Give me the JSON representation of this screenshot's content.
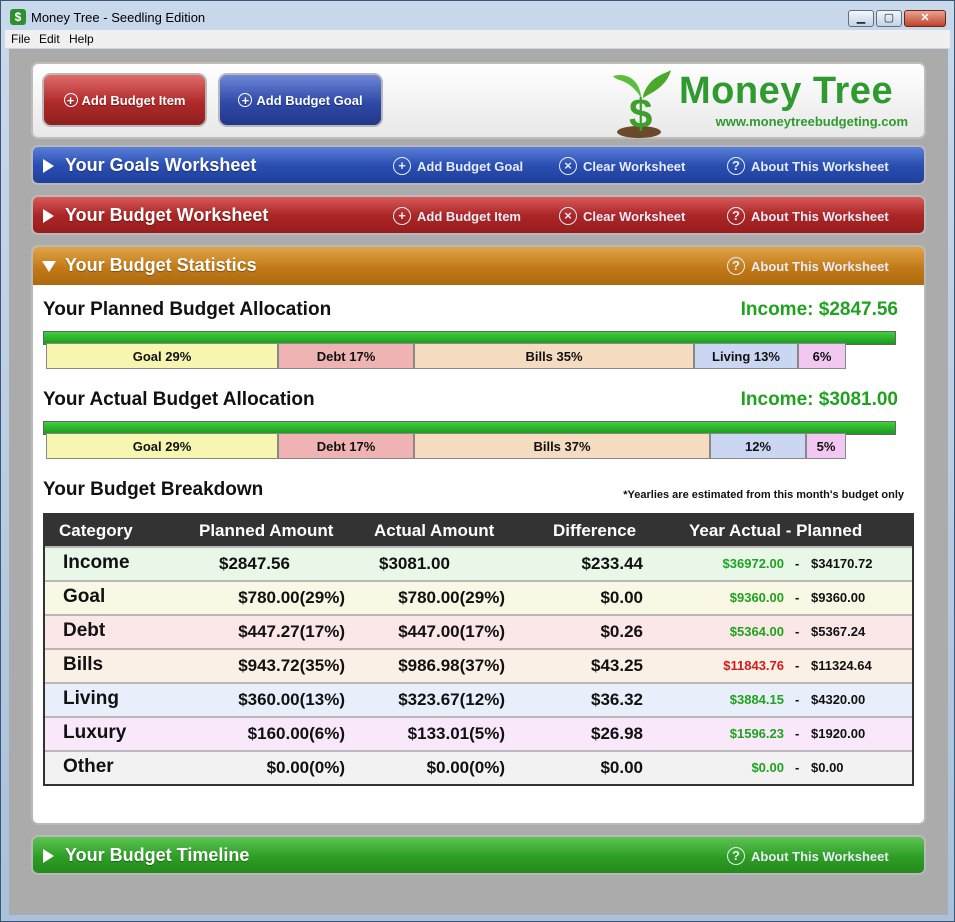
{
  "window": {
    "title": "Money Tree - Seedling Edition",
    "app_icon": "$"
  },
  "menu": [
    "File",
    "Edit",
    "Help"
  ],
  "header": {
    "add_item_label": "Add Budget Item",
    "add_goal_label": "Add Budget Goal",
    "logo_title": "Money Tree",
    "logo_url": "www.moneytreebudgeting.com"
  },
  "goals_section": {
    "title": "Your Goals Worksheet",
    "actions": [
      "Add Budget Goal",
      "Clear Worksheet",
      "About This Worksheet"
    ]
  },
  "budget_section": {
    "title": "Your Budget Worksheet",
    "actions": [
      "Add Budget Item",
      "Clear Worksheet",
      "About This Worksheet"
    ]
  },
  "stats_section": {
    "title": "Your Budget Statistics",
    "about": "About This Worksheet",
    "planned": {
      "title": "Your Planned Budget Allocation",
      "income": "Income: $2847.56",
      "segments": [
        {
          "label": "Goal 29%",
          "pct": 29,
          "color": "#f6f6b0"
        },
        {
          "label": "Debt 17%",
          "pct": 17,
          "color": "#f0b3b3"
        },
        {
          "label": "Bills 35%",
          "pct": 35,
          "color": "#f5dcc0"
        },
        {
          "label": "Living 13%",
          "pct": 13,
          "color": "#cad6f2"
        },
        {
          "label": "6%",
          "pct": 6,
          "color": "#f2c8f2"
        }
      ]
    },
    "actual": {
      "title": "Your Actual Budget Allocation",
      "income": "Income: $3081.00",
      "segments": [
        {
          "label": "Goal 29%",
          "pct": 29,
          "color": "#f6f6b0"
        },
        {
          "label": "Debt 17%",
          "pct": 17,
          "color": "#f0b3b3"
        },
        {
          "label": "Bills 37%",
          "pct": 37,
          "color": "#f5dcc0"
        },
        {
          "label": "12%",
          "pct": 12,
          "color": "#cad6f2"
        },
        {
          "label": "5%",
          "pct": 5,
          "color": "#f2c8f2"
        }
      ]
    },
    "breakdown": {
      "title": "Your Budget Breakdown",
      "note": "*Yearlies are estimated from this month's budget only",
      "headers": [
        "Category",
        "Planned Amount",
        "Actual Amount",
        "Difference",
        "Year Actual - Planned"
      ],
      "rows": [
        {
          "category": "Income",
          "planned": "$2847.56",
          "actual": "$3081.00",
          "diff": "$233.44",
          "year_actual": "$36972.00",
          "year_planned": "$34170.72",
          "bg": "#e8f7e8",
          "ya_color": "#1fa31f"
        },
        {
          "category": "Goal",
          "planned": "$780.00(29%)",
          "actual": "$780.00(29%)",
          "diff": "$0.00",
          "year_actual": "$9360.00",
          "year_planned": "$9360.00",
          "bg": "#f8f8e4",
          "ya_color": "#1fa31f"
        },
        {
          "category": "Debt",
          "planned": "$447.27(17%)",
          "actual": "$447.00(17%)",
          "diff": "$0.26",
          "year_actual": "$5364.00",
          "year_planned": "$5367.24",
          "bg": "#fbe7e7",
          "ya_color": "#1fa31f"
        },
        {
          "category": "Bills",
          "planned": "$943.72(35%)",
          "actual": "$986.98(37%)",
          "diff": "$43.25",
          "year_actual": "$11843.76",
          "year_planned": "$11324.64",
          "bg": "#fbf0e5",
          "ya_color": "#d21a1a"
        },
        {
          "category": "Living",
          "planned": "$360.00(13%)",
          "actual": "$323.67(12%)",
          "diff": "$36.32",
          "year_actual": "$3884.15",
          "year_planned": "$4320.00",
          "bg": "#e9eefb",
          "ya_color": "#1fa31f"
        },
        {
          "category": "Luxury",
          "planned": "$160.00(6%)",
          "actual": "$133.01(5%)",
          "diff": "$26.98",
          "year_actual": "$1596.23",
          "year_planned": "$1920.00",
          "bg": "#f9e8f9",
          "ya_color": "#1fa31f"
        },
        {
          "category": "Other",
          "planned": "$0.00(0%)",
          "actual": "$0.00(0%)",
          "diff": "$0.00",
          "year_actual": "$0.00",
          "year_planned": "$0.00",
          "bg": "#f2f2f2",
          "ya_color": "#1fa31f"
        }
      ]
    }
  },
  "timeline_section": {
    "title": "Your Budget Timeline",
    "about": "About This Worksheet"
  }
}
